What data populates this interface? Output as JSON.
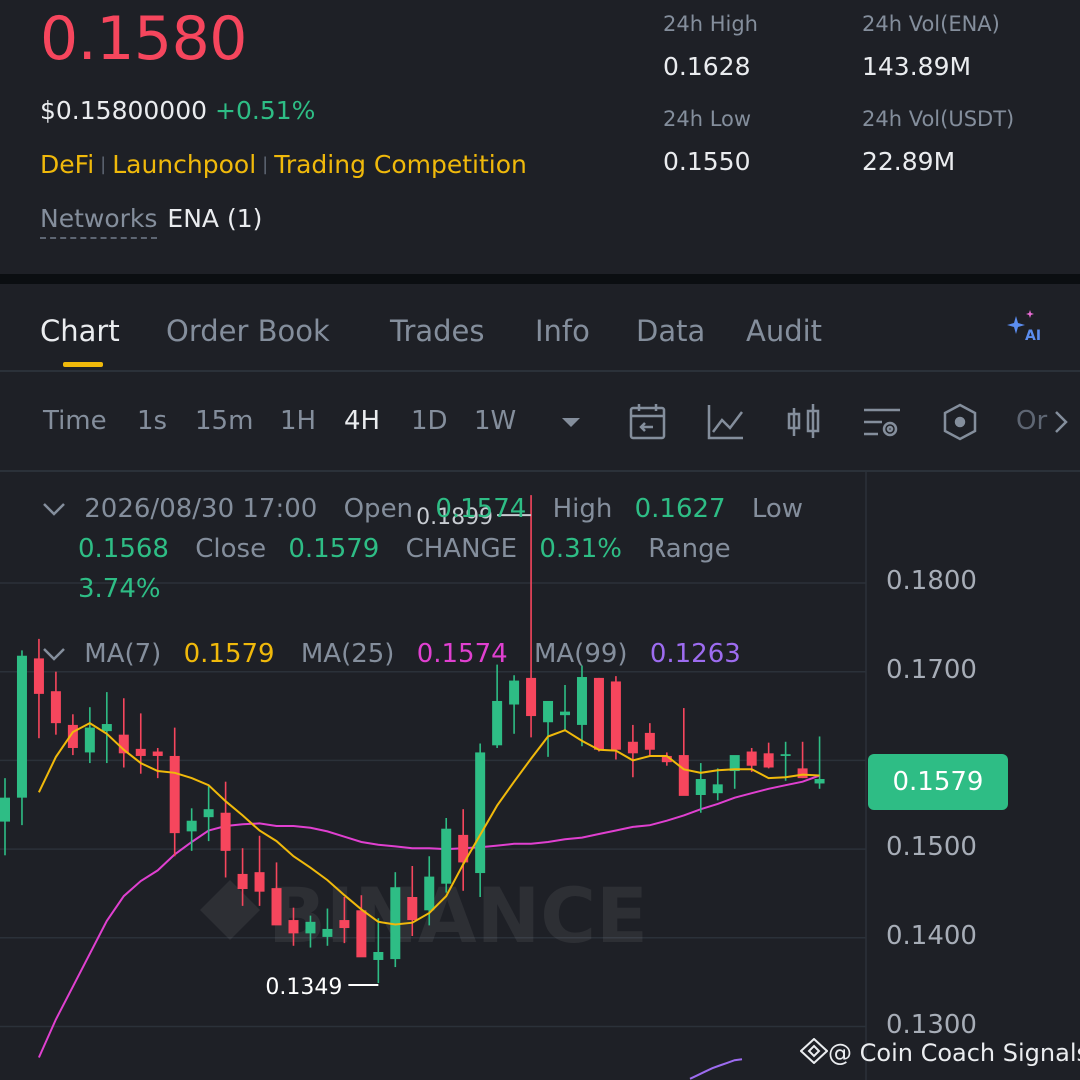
{
  "header": {
    "last_price": "0.1580",
    "usd_price": "$0.15800000",
    "change_pct": "+0.51%",
    "tags": [
      "DeFi",
      "Launchpool",
      "Trading Competition"
    ],
    "networks_label": "Networks",
    "networks_value": "ENA (1)",
    "stats": [
      {
        "label": "24h High",
        "value": "0.1628"
      },
      {
        "label": "24h Vol(ENA)",
        "value": "143.89M"
      },
      {
        "label": "24h Low",
        "value": "0.1550"
      },
      {
        "label": "24h Vol(USDT)",
        "value": "22.89M"
      }
    ]
  },
  "tabs": [
    "Chart",
    "Order Book",
    "Trades",
    "Info",
    "Data",
    "Audit"
  ],
  "active_tab": "Chart",
  "ai_icon_label": "AI",
  "toolbar": {
    "timeframes": [
      "Time",
      "1s",
      "15m",
      "1H",
      "4H",
      "1D",
      "1W"
    ],
    "active_timeframe": "4H",
    "more_label": "Or",
    "icons": [
      "chevron-down-icon",
      "calendar-icon",
      "line-chart-icon",
      "candles-icon",
      "settings-icon",
      "indicator-hexagon-icon",
      "chevron-right-icon"
    ]
  },
  "ohlc": {
    "datetime": "2026/08/30 17:00",
    "open_label": "Open",
    "open": "0.1574",
    "high_label": "High",
    "high": "0.1627",
    "low_label": "Low",
    "low": "0.1568",
    "close_label": "Close",
    "close": "0.1579",
    "change_label": "CHANGE",
    "change": "0.31%",
    "range_label": "Range",
    "range": "3.74%"
  },
  "ma": {
    "ma7_label": "MA(7)",
    "ma7": "0.1579",
    "ma25_label": "MA(25)",
    "ma25": "0.1574",
    "ma99_label": "MA(99)",
    "ma99": "0.1263"
  },
  "chart_data": {
    "type": "candlestick",
    "y_axis_labels": [
      "0.1800",
      "0.1700",
      "0.1500",
      "0.1400",
      "0.1300"
    ],
    "y_axis_ticks": [
      0.18,
      0.17,
      0.16,
      0.15,
      0.14,
      0.13
    ],
    "ylim": [
      0.1241,
      0.1919
    ],
    "max_label": "0.1899",
    "min_label": "0.1349",
    "last_price_label": "0.1579",
    "watermark": "BINANCE",
    "colors": {
      "up": "#2ebd85",
      "down": "#f6465d",
      "ma7": "#f0b90b",
      "ma25": "#e040d0",
      "ma99": "#9d6cf0"
    },
    "candles": [
      {
        "o": 0.1531,
        "h": 0.158,
        "l": 0.1493,
        "c": 0.1558
      },
      {
        "o": 0.1558,
        "h": 0.1724,
        "l": 0.1527,
        "c": 0.1718
      },
      {
        "o": 0.1715,
        "h": 0.1737,
        "l": 0.1625,
        "c": 0.1675
      },
      {
        "o": 0.1678,
        "h": 0.17,
        "l": 0.1629,
        "c": 0.1642
      },
      {
        "o": 0.164,
        "h": 0.1652,
        "l": 0.1606,
        "c": 0.1614
      },
      {
        "o": 0.1609,
        "h": 0.166,
        "l": 0.1597,
        "c": 0.1637
      },
      {
        "o": 0.1633,
        "h": 0.1677,
        "l": 0.1597,
        "c": 0.1641
      },
      {
        "o": 0.1629,
        "h": 0.167,
        "l": 0.1592,
        "c": 0.1608
      },
      {
        "o": 0.1613,
        "h": 0.1653,
        "l": 0.1585,
        "c": 0.1605
      },
      {
        "o": 0.161,
        "h": 0.1614,
        "l": 0.158,
        "c": 0.1605
      },
      {
        "o": 0.1605,
        "h": 0.1637,
        "l": 0.1492,
        "c": 0.1518
      },
      {
        "o": 0.152,
        "h": 0.1546,
        "l": 0.1498,
        "c": 0.1532
      },
      {
        "o": 0.1536,
        "h": 0.1571,
        "l": 0.1509,
        "c": 0.1545
      },
      {
        "o": 0.1541,
        "h": 0.1576,
        "l": 0.1468,
        "c": 0.1498
      },
      {
        "o": 0.1472,
        "h": 0.1501,
        "l": 0.1436,
        "c": 0.1455
      },
      {
        "o": 0.1474,
        "h": 0.1515,
        "l": 0.1436,
        "c": 0.1452
      },
      {
        "o": 0.1456,
        "h": 0.1485,
        "l": 0.1434,
        "c": 0.1414
      },
      {
        "o": 0.142,
        "h": 0.1434,
        "l": 0.1391,
        "c": 0.1405
      },
      {
        "o": 0.1405,
        "h": 0.1425,
        "l": 0.1389,
        "c": 0.1418
      },
      {
        "o": 0.1401,
        "h": 0.1433,
        "l": 0.1391,
        "c": 0.141
      },
      {
        "o": 0.142,
        "h": 0.1446,
        "l": 0.1394,
        "c": 0.1411
      },
      {
        "o": 0.1431,
        "h": 0.1448,
        "l": 0.1391,
        "c": 0.1378
      },
      {
        "o": 0.1375,
        "h": 0.1422,
        "l": 0.1349,
        "c": 0.1384
      },
      {
        "o": 0.1376,
        "h": 0.1474,
        "l": 0.1367,
        "c": 0.1457
      },
      {
        "o": 0.1446,
        "h": 0.1481,
        "l": 0.1402,
        "c": 0.142
      },
      {
        "o": 0.1431,
        "h": 0.1492,
        "l": 0.1414,
        "c": 0.1469
      },
      {
        "o": 0.1461,
        "h": 0.1535,
        "l": 0.1451,
        "c": 0.1523
      },
      {
        "o": 0.1516,
        "h": 0.1545,
        "l": 0.1453,
        "c": 0.1485
      },
      {
        "o": 0.1473,
        "h": 0.1619,
        "l": 0.1446,
        "c": 0.1609
      },
      {
        "o": 0.1617,
        "h": 0.1708,
        "l": 0.1614,
        "c": 0.1667
      },
      {
        "o": 0.1663,
        "h": 0.1696,
        "l": 0.163,
        "c": 0.169
      },
      {
        "o": 0.1693,
        "h": 0.1899,
        "l": 0.1626,
        "c": 0.165
      },
      {
        "o": 0.1643,
        "h": 0.1664,
        "l": 0.1604,
        "c": 0.1667
      },
      {
        "o": 0.1651,
        "h": 0.1685,
        "l": 0.1634,
        "c": 0.1655
      },
      {
        "o": 0.164,
        "h": 0.1707,
        "l": 0.1616,
        "c": 0.1694
      },
      {
        "o": 0.1693,
        "h": 0.1693,
        "l": 0.161,
        "c": 0.1612
      },
      {
        "o": 0.1689,
        "h": 0.1695,
        "l": 0.1601,
        "c": 0.1612
      },
      {
        "o": 0.1621,
        "h": 0.164,
        "l": 0.1581,
        "c": 0.1608
      },
      {
        "o": 0.1631,
        "h": 0.1642,
        "l": 0.1605,
        "c": 0.1612
      },
      {
        "o": 0.1605,
        "h": 0.1609,
        "l": 0.1594,
        "c": 0.1598
      },
      {
        "o": 0.1606,
        "h": 0.1659,
        "l": 0.1582,
        "c": 0.156
      },
      {
        "o": 0.1561,
        "h": 0.1597,
        "l": 0.1541,
        "c": 0.1579
      },
      {
        "o": 0.1563,
        "h": 0.1591,
        "l": 0.1555,
        "c": 0.1573
      },
      {
        "o": 0.1588,
        "h": 0.1599,
        "l": 0.1568,
        "c": 0.1606
      },
      {
        "o": 0.161,
        "h": 0.1614,
        "l": 0.1587,
        "c": 0.1594
      },
      {
        "o": 0.1608,
        "h": 0.162,
        "l": 0.1591,
        "c": 0.1592
      },
      {
        "o": 0.1605,
        "h": 0.1621,
        "l": 0.1577,
        "c": 0.1607
      },
      {
        "o": 0.1591,
        "h": 0.1621,
        "l": 0.158,
        "c": 0.158
      },
      {
        "o": 0.1574,
        "h": 0.1627,
        "l": 0.1568,
        "c": 0.1579
      }
    ],
    "ma7": [
      0.1564,
      0.1604,
      0.1632,
      0.1642,
      0.163,
      0.1612,
      0.1597,
      0.1588,
      0.1586,
      0.158,
      0.1572,
      0.1554,
      0.1538,
      0.1521,
      0.1509,
      0.1492,
      0.1479,
      0.1465,
      0.1448,
      0.1432,
      0.1418,
      0.1415,
      0.1417,
      0.1428,
      0.1447,
      0.1483,
      0.1516,
      0.1549,
      0.1576,
      0.1602,
      0.1627,
      0.1634,
      0.1622,
      0.1612,
      0.1611,
      0.16,
      0.1605,
      0.1605,
      0.159,
      0.1586,
      0.1589,
      0.159,
      0.159,
      0.158,
      0.1581,
      0.1584,
      0.1583
    ],
    "ma25": [
      0.1265,
      0.1308,
      0.1345,
      0.1382,
      0.1419,
      0.1447,
      0.1464,
      0.1476,
      0.1494,
      0.1508,
      0.1521,
      0.1526,
      0.1528,
      0.1529,
      0.1526,
      0.1526,
      0.1524,
      0.152,
      0.1514,
      0.1508,
      0.1505,
      0.1503,
      0.1501,
      0.1501,
      0.15,
      0.1501,
      0.1502,
      0.1504,
      0.1506,
      0.1506,
      0.1508,
      0.1511,
      0.1513,
      0.1517,
      0.1521,
      0.1525,
      0.1527,
      0.1532,
      0.1538,
      0.1545,
      0.1551,
      0.1558,
      0.1563,
      0.1568,
      0.1572,
      0.1576,
      0.1583
    ],
    "ma99": [
      0.1241,
      0.1245,
      0.1249,
      0.1253,
      0.1256,
      0.1259,
      0.1262,
      0.1263
    ]
  },
  "watermark_text": "@ Coin Coach Signals"
}
